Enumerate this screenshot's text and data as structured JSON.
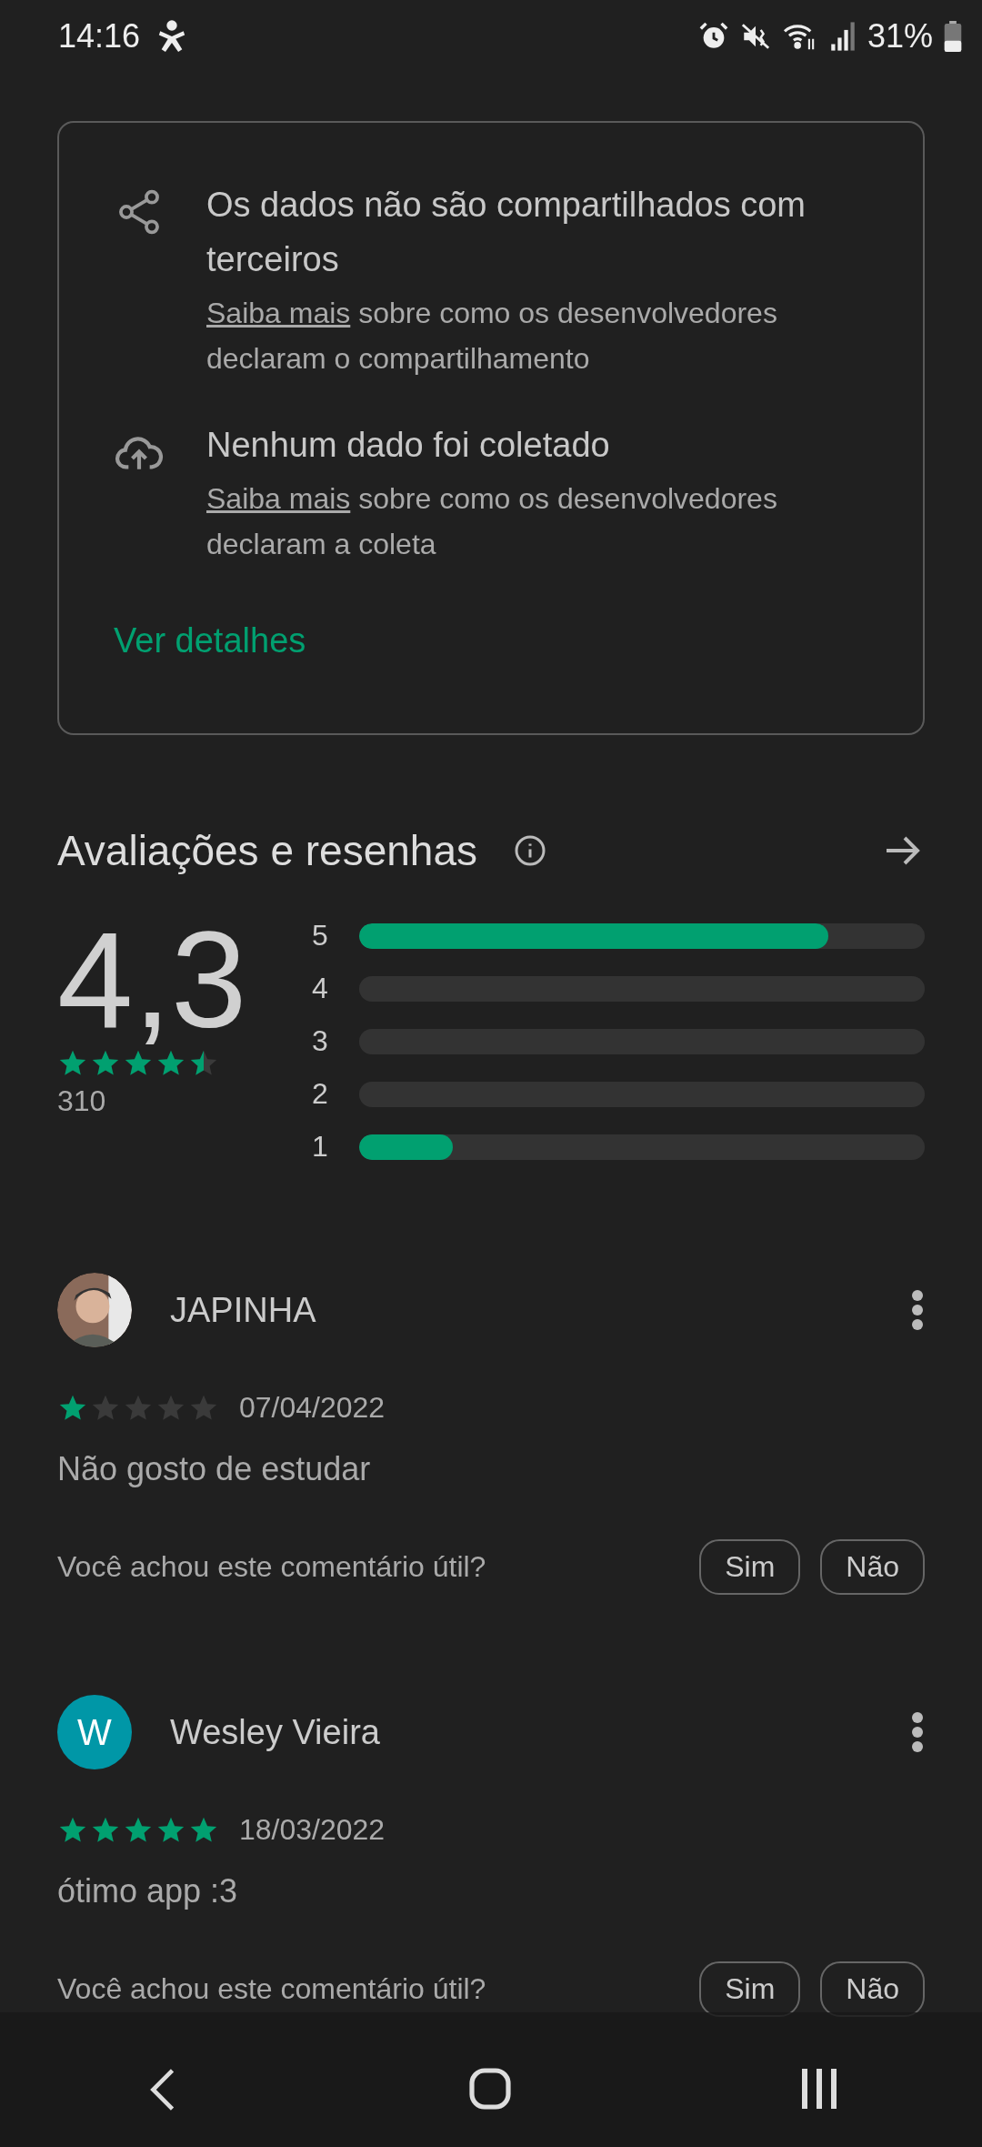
{
  "status_bar": {
    "time": "14:16",
    "battery": "31%"
  },
  "data_safety": {
    "items": [
      {
        "kind": "sharing",
        "title": "Os dados não são compartilhados com terceiros",
        "link": "Saiba mais",
        "text": " sobre como os desenvolvedores declaram o compartilhamento"
      },
      {
        "kind": "collection",
        "title": "Nenhum dado foi coletado",
        "link": "Saiba mais",
        "text": " sobre como os desenvolvedores declaram a coleta"
      }
    ],
    "details_link": "Ver detalhes"
  },
  "ratings": {
    "title": "Avaliações e resenhas",
    "score": "4,3",
    "stars": 4.5,
    "count": "310",
    "bars": [
      {
        "label": "5",
        "level": 0.83
      },
      {
        "label": "4",
        "level": 0
      },
      {
        "label": "3",
        "level": 0
      },
      {
        "label": "2",
        "level": 0
      },
      {
        "label": "1",
        "level": 0.165
      }
    ]
  },
  "reviews": [
    {
      "name": "JAPINHA",
      "stars": 1,
      "date": "07/04/2022",
      "text": "Não gosto de estudar",
      "question": "Você achou este comentário útil?",
      "buttons": [
        "Sim",
        "Não"
      ]
    },
    {
      "avatar": {
        "kind": "initial",
        "letter": "W"
      },
      "name": "Wesley Vieira",
      "stars": 5,
      "date": "18/03/2022",
      "text": "ótimo app :3",
      "question": "Você achou este comentário útil?",
      "buttons": [
        "Sim",
        "Não"
      ]
    }
  ]
}
